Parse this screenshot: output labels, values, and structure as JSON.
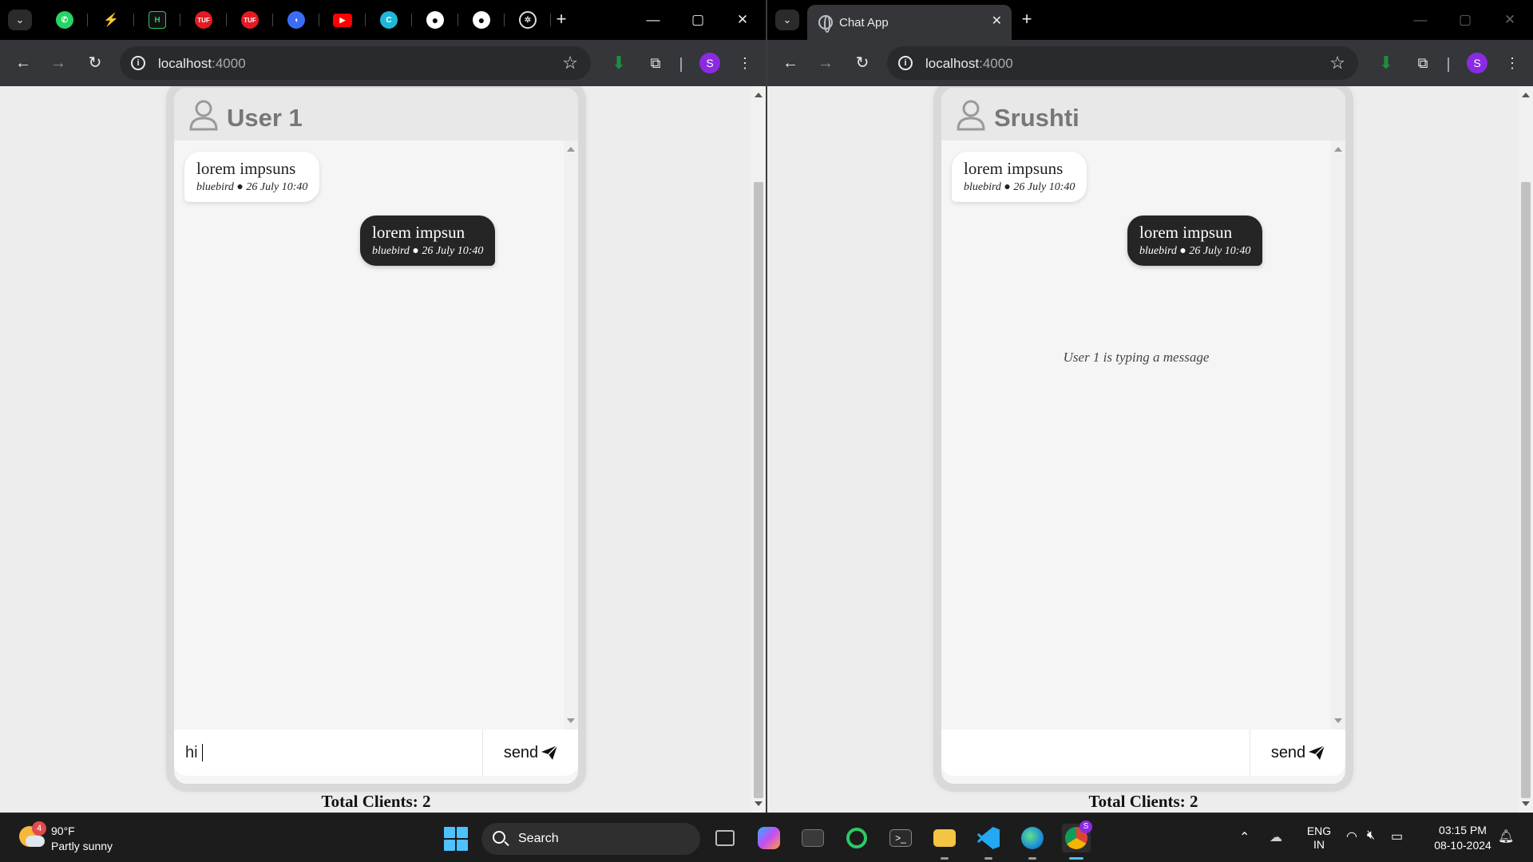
{
  "windows": {
    "left": {
      "tab_title": "",
      "pinned_tabs": [
        "whatsapp-icon",
        "ecommerce-icon",
        "hackerrank-icon",
        "tuf-icon",
        "tuf-icon",
        "app-icon",
        "youtube-icon",
        "canva-icon",
        "github-icon",
        "github-icon",
        "chatgpt-icon"
      ],
      "url_host": "localhost",
      "url_port": ":4000",
      "profile_initial": "S",
      "chat": {
        "username": "User 1",
        "messages": [
          {
            "text": "lorem impsuns",
            "meta": "bluebird ● 26 July 10:40",
            "direction": "incoming"
          },
          {
            "text": "lorem impsun",
            "meta": "bluebird ● 26 July 10:40",
            "direction": "outgoing"
          }
        ],
        "typing_indicator": "",
        "input_value": "hi",
        "input_placeholder": "",
        "send_label": "send"
      },
      "total_clients": "Total Clients: 2"
    },
    "right": {
      "tab_title": "Chat App",
      "url_host": "localhost",
      "url_port": ":4000",
      "profile_initial": "S",
      "chat": {
        "username": "Srushti",
        "messages": [
          {
            "text": "lorem impsuns",
            "meta": "bluebird ● 26 July 10:40",
            "direction": "incoming"
          },
          {
            "text": "lorem impsun",
            "meta": "bluebird ● 26 July 10:40",
            "direction": "outgoing"
          }
        ],
        "typing_indicator": "User 1 is typing a message",
        "input_value": "",
        "input_placeholder": "",
        "send_label": "send"
      },
      "total_clients": "Total Clients: 2"
    }
  },
  "taskbar": {
    "weather_temp": "90°F",
    "weather_desc": "Partly sunny",
    "weather_badge": "4",
    "search_label": "Search",
    "language_line1": "ENG",
    "language_line2": "IN",
    "time": "03:15 PM",
    "date": "08-10-2024",
    "chrome_badge": "S"
  },
  "colors": {
    "outgoing_bubble": "#252525",
    "incoming_bubble": "#ffffff",
    "header_bg": "#e8e8e8",
    "page_bg": "#ededed",
    "profile_avatar": "#8a2be2",
    "download_icon": "#1e8e3e"
  }
}
